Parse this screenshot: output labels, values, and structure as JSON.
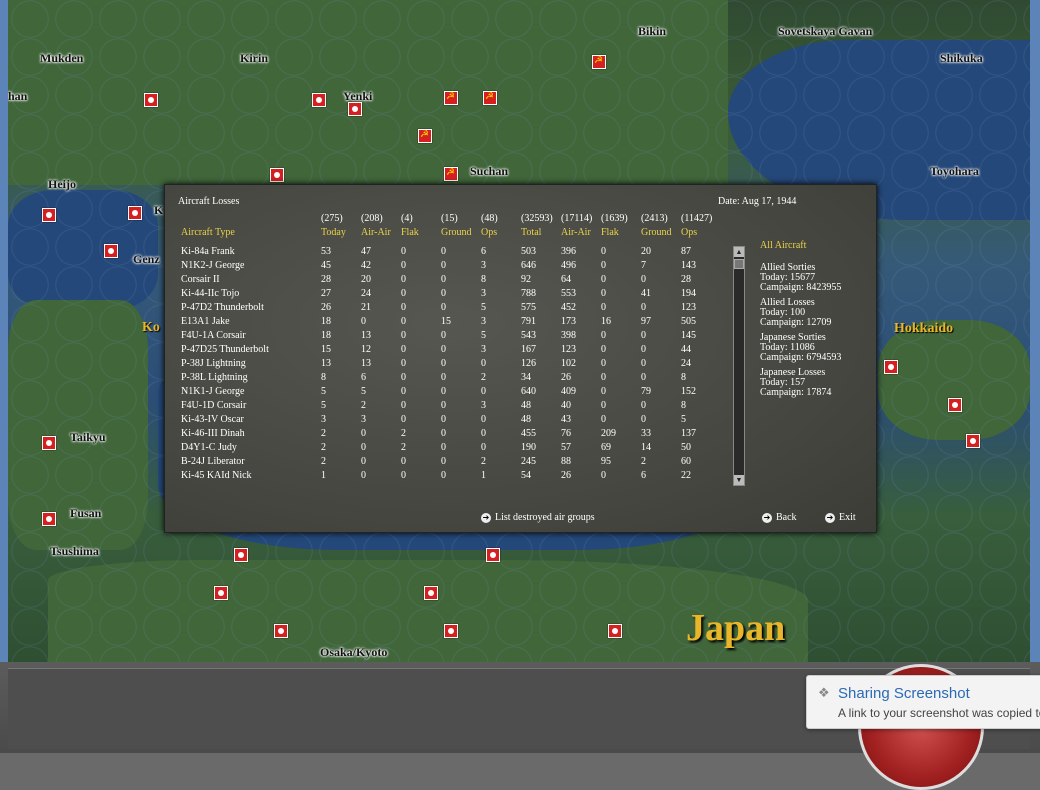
{
  "map": {
    "places": [
      {
        "name": "Bikin"
      },
      {
        "name": "Sovetskaya Gavan"
      },
      {
        "name": "Shikuka"
      },
      {
        "name": "Mukden"
      },
      {
        "name": "Kirin"
      },
      {
        "name": "Yenki"
      },
      {
        "name": "Suchan"
      },
      {
        "name": "Toyohara"
      },
      {
        "name": "Heijo"
      },
      {
        "name": "Genz"
      },
      {
        "name": "Taikyu"
      },
      {
        "name": "Fusan"
      },
      {
        "name": "Tsushima"
      },
      {
        "name": "Osaka/Kyoto"
      },
      {
        "name": "han"
      },
      {
        "name": "K"
      }
    ],
    "regions": [
      {
        "name": "Ko"
      },
      {
        "name": "Hokkaido"
      }
    ],
    "big_region": "Japan"
  },
  "dialog": {
    "title": "Aircraft Losses",
    "date": "Date: Aug 17, 1944",
    "totals": [
      "(275)",
      "(208)",
      "(4)",
      "(15)",
      "(48)",
      "(32593)",
      "(17114)",
      "(1639)",
      "(2413)",
      "(11427)"
    ],
    "headers": [
      "Aircraft Type",
      "Today",
      "Air-Air",
      "Flak",
      "Ground",
      "Ops",
      "Total",
      "Air-Air",
      "Flak",
      "Ground",
      "Ops"
    ],
    "rows": [
      [
        "Ki-84a Frank",
        "53",
        "47",
        "0",
        "0",
        "6",
        "503",
        "396",
        "0",
        "20",
        "87"
      ],
      [
        "N1K2-J George",
        "45",
        "42",
        "0",
        "0",
        "3",
        "646",
        "496",
        "0",
        "7",
        "143"
      ],
      [
        "Corsair II",
        "28",
        "20",
        "0",
        "0",
        "8",
        "92",
        "64",
        "0",
        "0",
        "28"
      ],
      [
        "Ki-44-IIc Tojo",
        "27",
        "24",
        "0",
        "0",
        "3",
        "788",
        "553",
        "0",
        "41",
        "194"
      ],
      [
        "P-47D2 Thunderbolt",
        "26",
        "21",
        "0",
        "0",
        "5",
        "575",
        "452",
        "0",
        "0",
        "123"
      ],
      [
        "E13A1 Jake",
        "18",
        "0",
        "0",
        "15",
        "3",
        "791",
        "173",
        "16",
        "97",
        "505"
      ],
      [
        "F4U-1A Corsair",
        "18",
        "13",
        "0",
        "0",
        "5",
        "543",
        "398",
        "0",
        "0",
        "145"
      ],
      [
        "P-47D25 Thunderbolt",
        "15",
        "12",
        "0",
        "0",
        "3",
        "167",
        "123",
        "0",
        "0",
        "44"
      ],
      [
        "P-38J Lightning",
        "13",
        "13",
        "0",
        "0",
        "0",
        "126",
        "102",
        "0",
        "0",
        "24"
      ],
      [
        "P-38L Lightning",
        "8",
        "6",
        "0",
        "0",
        "2",
        "34",
        "26",
        "0",
        "0",
        "8"
      ],
      [
        "N1K1-J George",
        "5",
        "5",
        "0",
        "0",
        "0",
        "640",
        "409",
        "0",
        "79",
        "152"
      ],
      [
        "F4U-1D Corsair",
        "5",
        "2",
        "0",
        "0",
        "3",
        "48",
        "40",
        "0",
        "0",
        "8"
      ],
      [
        "Ki-43-IV Oscar",
        "3",
        "3",
        "0",
        "0",
        "0",
        "48",
        "43",
        "0",
        "0",
        "5"
      ],
      [
        "Ki-46-III Dinah",
        "2",
        "0",
        "2",
        "0",
        "0",
        "455",
        "76",
        "209",
        "33",
        "137"
      ],
      [
        "D4Y1-C Judy",
        "2",
        "0",
        "2",
        "0",
        "0",
        "190",
        "57",
        "69",
        "14",
        "50"
      ],
      [
        "B-24J Liberator",
        "2",
        "0",
        "0",
        "0",
        "2",
        "245",
        "88",
        "95",
        "2",
        "60"
      ],
      [
        "Ki-45 KAId Nick",
        "1",
        "0",
        "0",
        "0",
        "1",
        "54",
        "26",
        "0",
        "6",
        "22"
      ]
    ],
    "side": {
      "heading": "All Aircraft",
      "blocks": [
        {
          "title": "Allied Sorties",
          "today": "Today:  15677",
          "campaign": "Campaign: 8423955"
        },
        {
          "title": "Allied Losses",
          "today": "Today:  100",
          "campaign": "Campaign: 12709"
        },
        {
          "title": "Japanese Sorties",
          "today": "Today:  11086",
          "campaign": "Campaign: 6794593"
        },
        {
          "title": "Japanese Losses",
          "today": "Today:  157",
          "campaign": "Campaign: 17874"
        }
      ]
    },
    "buttons": {
      "list_destroyed": "List destroyed air groups",
      "back": "Back",
      "exit": "Exit"
    }
  },
  "toast": {
    "title": "Sharing Screenshot",
    "body": "A link to your screenshot was copied to"
  }
}
